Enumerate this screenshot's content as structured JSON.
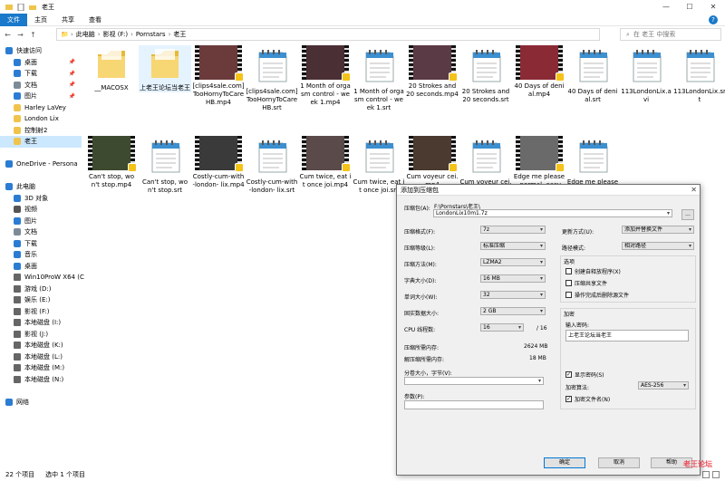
{
  "window": {
    "title": "老王",
    "minimize": "—",
    "maximize": "☐",
    "close": "✕"
  },
  "ribbon": {
    "tabs": [
      "文件",
      "主页",
      "共享",
      "查看"
    ],
    "help": "?"
  },
  "addressbar": {
    "back": "←",
    "forward": "→",
    "up": "↑",
    "path": [
      "此电脑",
      "影视 (F:)",
      "Pornstars",
      "老王"
    ],
    "search_placeholder": "在 老王 中搜索"
  },
  "nav": {
    "items": [
      {
        "label": "快速访问",
        "icon": "star-icon",
        "color": "#2b7cd3",
        "indent": 0,
        "pinned": false
      },
      {
        "label": "桌面",
        "icon": "desktop-icon",
        "color": "#2b7cd3",
        "indent": 1,
        "pinned": true
      },
      {
        "label": "下载",
        "icon": "download-icon",
        "color": "#2b7cd3",
        "indent": 1,
        "pinned": true
      },
      {
        "label": "文档",
        "icon": "document-icon",
        "color": "#7d8b99",
        "indent": 1,
        "pinned": true
      },
      {
        "label": "图片",
        "icon": "picture-icon",
        "color": "#2b7cd3",
        "indent": 1,
        "pinned": true
      },
      {
        "label": "Harley LaVey",
        "icon": "folder-icon",
        "color": "#f0c44c",
        "indent": 1,
        "pinned": false
      },
      {
        "label": "London Lix",
        "icon": "folder-icon",
        "color": "#f0c44c",
        "indent": 1,
        "pinned": false
      },
      {
        "label": "控制射2",
        "icon": "folder-icon",
        "color": "#f0c44c",
        "indent": 1,
        "pinned": false
      },
      {
        "label": "老王",
        "icon": "folder-icon",
        "color": "#f0c44c",
        "indent": 1,
        "pinned": false,
        "selected": true
      },
      {
        "label": "",
        "icon": "",
        "color": "",
        "indent": 0,
        "pinned": false
      },
      {
        "label": "OneDrive - Persona",
        "icon": "cloud-icon",
        "color": "#2b7cd3",
        "indent": 0,
        "pinned": false
      },
      {
        "label": "",
        "icon": "",
        "color": "",
        "indent": 0,
        "pinned": false
      },
      {
        "label": "此电脑",
        "icon": "computer-icon",
        "color": "#2b7cd3",
        "indent": 0,
        "pinned": false
      },
      {
        "label": "3D 对象",
        "icon": "cube-icon",
        "color": "#2b7cd3",
        "indent": 1,
        "pinned": false
      },
      {
        "label": "视频",
        "icon": "video-icon",
        "color": "#555555",
        "indent": 1,
        "pinned": false
      },
      {
        "label": "图片",
        "icon": "picture-icon",
        "color": "#2b7cd3",
        "indent": 1,
        "pinned": false
      },
      {
        "label": "文档",
        "icon": "document-icon",
        "color": "#7d8b99",
        "indent": 1,
        "pinned": false
      },
      {
        "label": "下载",
        "icon": "download-icon",
        "color": "#2b7cd3",
        "indent": 1,
        "pinned": false
      },
      {
        "label": "音乐",
        "icon": "music-icon",
        "color": "#2b7cd3",
        "indent": 1,
        "pinned": false
      },
      {
        "label": "桌面",
        "icon": "desktop-icon",
        "color": "#2b7cd3",
        "indent": 1,
        "pinned": false
      },
      {
        "label": "Win10ProW X64 (C",
        "icon": "drive-icon",
        "color": "#666666",
        "indent": 1,
        "pinned": false
      },
      {
        "label": "游戏 (D:)",
        "icon": "drive-icon",
        "color": "#666666",
        "indent": 1,
        "pinned": false
      },
      {
        "label": "娱乐 (E:)",
        "icon": "drive-icon",
        "color": "#666666",
        "indent": 1,
        "pinned": false
      },
      {
        "label": "影视 (F:)",
        "icon": "drive-icon",
        "color": "#666666",
        "indent": 1,
        "pinned": false
      },
      {
        "label": "本地磁盘 (I:)",
        "icon": "drive-icon",
        "color": "#666666",
        "indent": 1,
        "pinned": false
      },
      {
        "label": "影视 (J:)",
        "icon": "drive-icon",
        "color": "#666666",
        "indent": 1,
        "pinned": false
      },
      {
        "label": "本地磁盘 (K:)",
        "icon": "drive-icon",
        "color": "#666666",
        "indent": 1,
        "pinned": false
      },
      {
        "label": "本地磁盘 (L:)",
        "icon": "drive-icon",
        "color": "#666666",
        "indent": 1,
        "pinned": false
      },
      {
        "label": "本地磁盘 (M:)",
        "icon": "drive-icon",
        "color": "#666666",
        "indent": 1,
        "pinned": false
      },
      {
        "label": "本地磁盘 (N:)",
        "icon": "drive-icon",
        "color": "#666666",
        "indent": 1,
        "pinned": false
      },
      {
        "label": "",
        "icon": "",
        "color": "",
        "indent": 0,
        "pinned": false
      },
      {
        "label": "网络",
        "icon": "network-icon",
        "color": "#2b7cd3",
        "indent": 0,
        "pinned": false
      }
    ]
  },
  "files": [
    {
      "name": "__MACOSX",
      "kind": "folder"
    },
    {
      "name": "上老王论坛当老王",
      "kind": "folder",
      "selected": true
    },
    {
      "name": "[clips4sale.com] TooHornyToCareHB.mp4",
      "kind": "video",
      "tint": "#6b3b3b"
    },
    {
      "name": "[clips4sale.com] TooHornyToCareHB.srt",
      "kind": "note"
    },
    {
      "name": "1 Month of orgasm control - week 1.mp4",
      "kind": "video",
      "tint": "#4a2f35"
    },
    {
      "name": "1 Month of orgasm control - week 1.srt",
      "kind": "note"
    },
    {
      "name": "20 Strokes and 20 seconds.mp4",
      "kind": "video",
      "tint": "#5a3a45"
    },
    {
      "name": "20 Strokes and 20 seconds.srt",
      "kind": "note"
    },
    {
      "name": "40 Days of denial.mp4",
      "kind": "video",
      "tint": "#8a2a35"
    },
    {
      "name": "40 Days of denial.srt",
      "kind": "note"
    },
    {
      "name": "113LondonLix.avi",
      "kind": "note"
    },
    {
      "name": "113LondonLix.srt",
      "kind": "note"
    },
    {
      "name": "Can't stop, won't stop.mp4",
      "kind": "video",
      "tint": "#3d4a2f"
    },
    {
      "name": "Can't stop, won't stop.srt",
      "kind": "note"
    },
    {
      "name": "Costly-cum-with-london- lix.mp4",
      "kind": "video",
      "tint": "#3a3a3a"
    },
    {
      "name": "Costly-cum-with-london- lix.srt",
      "kind": "note"
    },
    {
      "name": "Cum twice, eat it once joi.mp4",
      "kind": "video",
      "tint": "#5a4a4a"
    },
    {
      "name": "Cum twice, eat it once joi.srt",
      "kind": "note"
    },
    {
      "name": "Cum voyeur cei.mp4",
      "kind": "video",
      "tint": "#4a3a30"
    },
    {
      "name": "Cum voyeur cei.srt",
      "kind": "note"
    },
    {
      "name": "Edge me please - normal, easy, mystery.mp4",
      "kind": "video",
      "tint": "#6a6a6a"
    },
    {
      "name": "Edge me please - normal, easy, mystery.srt",
      "kind": "note"
    }
  ],
  "status": {
    "count": "22 个项目",
    "selected": "选中 1 个项目"
  },
  "dialog": {
    "title": "添加到压缩包",
    "close": "✕",
    "archive_label": "压缩包(A):",
    "archive_dir": "F:\\Pornstars\\老王\\",
    "archive_name": "LondonLix10m1.7z",
    "browse": "...",
    "format_label": "压缩格式(F):",
    "format": "7z",
    "level_label": "压缩等级(L):",
    "level": "标准压缩",
    "method_label": "压缩方法(M):",
    "method": "LZMA2",
    "dict_label": "字典大小(D):",
    "dict": "16 MB",
    "word_label": "单词大小(W):",
    "word": "32",
    "solid_label": "固实数据大小:",
    "solid": "2 GB",
    "cpu_label": "CPU 线程数:",
    "cpu": "16",
    "cpu_total": "/ 16",
    "mem_comp_label": "压缩所需内存:",
    "mem_comp": "2624 MB",
    "mem_decomp_label": "解压缩所需内存:",
    "mem_decomp": "18 MB",
    "split_label": "分卷大小，字节(V):",
    "params_label": "参数(P):",
    "update_label": "更新方式(U):",
    "update": "添加并替换文件",
    "path_label": "路径模式:",
    "path": "相对路径",
    "options_label": "选项",
    "opt_sfx": "创建自释放程序(X)",
    "opt_shared": "压缩共享文件",
    "opt_delete": "操作完成后删除源文件",
    "encrypt_label": "加密",
    "password_label": "输入密码:",
    "password": "上老王论坛当老王",
    "show_pw": "显示密码(S)",
    "enc_method_label": "加密算法:",
    "enc_method": "AES-256",
    "encrypt_names": "加密文件名(N)",
    "ok": "确定",
    "cancel": "取消",
    "help": "帮助"
  },
  "watermark": "老王论坛"
}
